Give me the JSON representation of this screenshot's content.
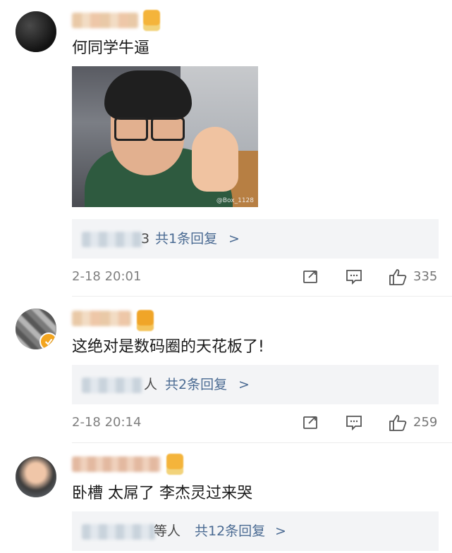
{
  "comments": [
    {
      "content": "何同学牛逼",
      "image_watermark": "@Box_1128",
      "reply_suffix": "3",
      "reply_link": "共1条回复",
      "reply_chevron": ">",
      "time": "2-18 20:01",
      "likes": "335"
    },
    {
      "content": "这绝对是数码圈的天花板了!",
      "reply_suffix": "人",
      "reply_link": "共2条回复",
      "reply_chevron": ">",
      "time": "2-18 20:14",
      "likes": "259"
    },
    {
      "content": "卧槽 太屌了 李杰灵过来哭",
      "reply_suffix": "等人",
      "reply_link": "共12条回复",
      "reply_chevron": ">"
    }
  ],
  "icons": {
    "share": "share-icon",
    "comment": "comment-icon",
    "like": "thumbs-up-icon",
    "verified": "verified-badge-icon"
  },
  "colors": {
    "link": "#4a6a92",
    "muted": "#808080",
    "reply_bg": "#f3f4f6"
  }
}
